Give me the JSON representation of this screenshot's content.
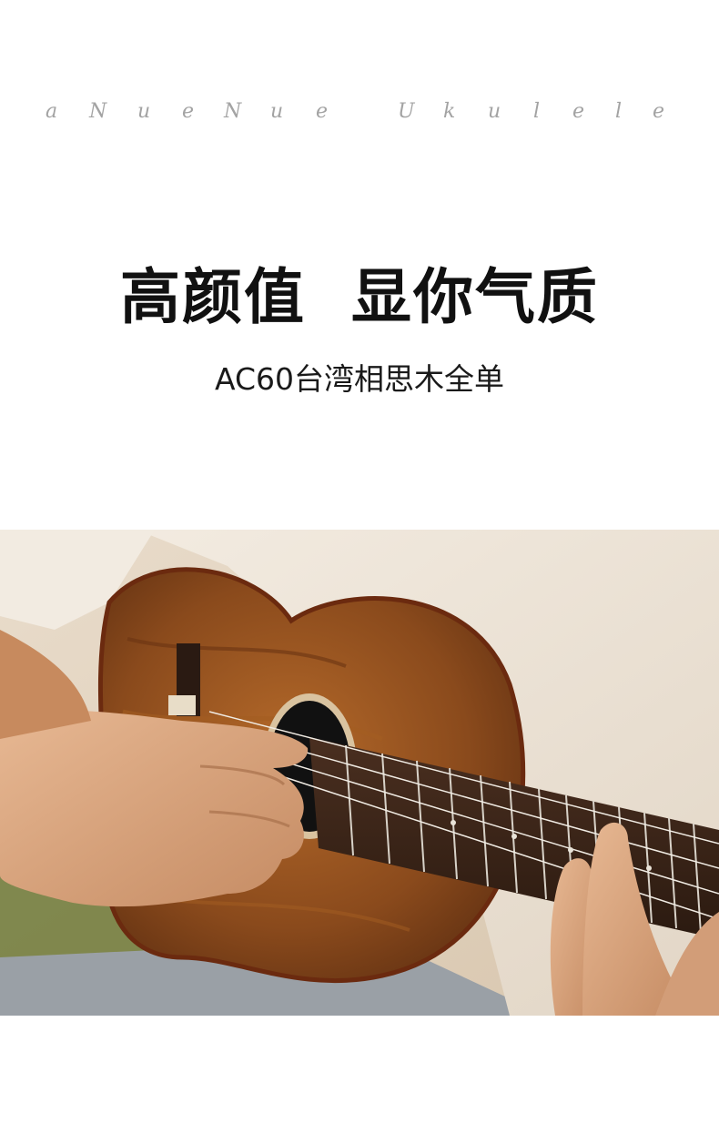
{
  "brand": {
    "letters": [
      "a",
      "N",
      "u",
      "e",
      "N",
      "u",
      "e",
      "U",
      "k",
      "u",
      "l",
      "e",
      "l",
      "e"
    ]
  },
  "headline": "高颜值  显你气质",
  "subheadline": "AC60台湾相思木全单",
  "photo": {
    "subject": "ukulele-being-played",
    "colors": {
      "wood": "#8a4a1c",
      "shirt": "#efe7dc",
      "skin": "#d9a27c",
      "fretboard": "#3a2418",
      "grass": "#6f7a3a",
      "jeans": "#9aa0a6"
    }
  }
}
